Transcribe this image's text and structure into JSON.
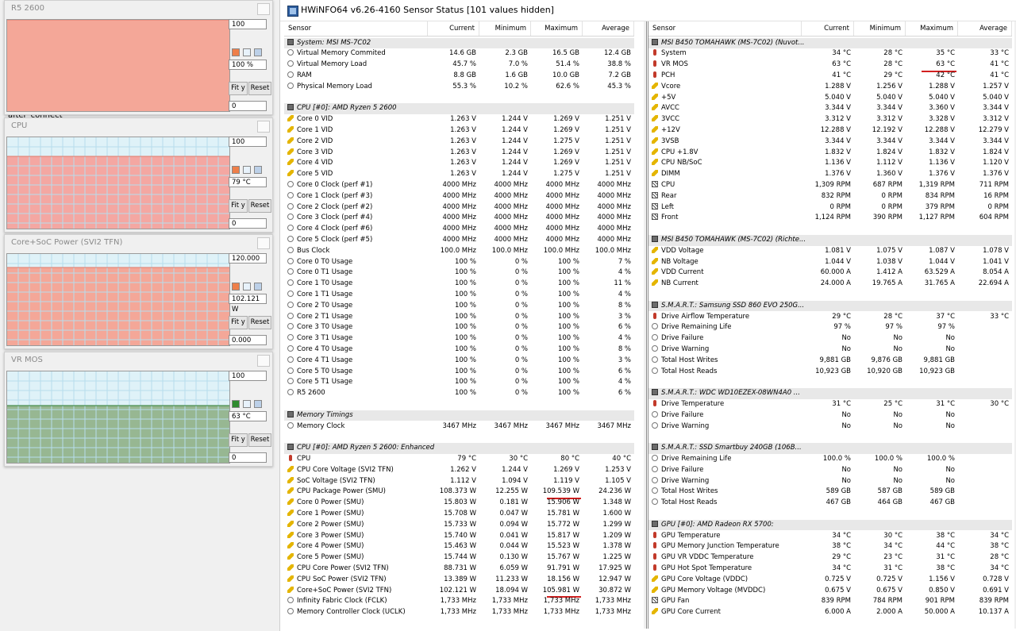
{
  "background": {
    "fragment_text": "after_connect"
  },
  "graphs": [
    {
      "title": "R5 2600",
      "max": "100",
      "current": "100 %",
      "min": "0",
      "fit": "Fit y",
      "reset": "Reset",
      "level": 1.0,
      "color": "#f4a798",
      "grid": "#f4a798",
      "band": "#f4a798",
      "swatch": "#ee7f4a"
    },
    {
      "title": "CPU",
      "max": "100",
      "current": "79 °C",
      "min": "0",
      "fit": "Fit y",
      "reset": "Reset",
      "level": 0.79,
      "color": "#f4a7a2",
      "grid": "#b7dcec",
      "band": "#dff2f8",
      "swatch": "#ee7f4a"
    },
    {
      "title": "Core+SoC Power (SVI2 TFN)",
      "max": "120.000",
      "current": "102.121 W",
      "min": "0.000",
      "fit": "Fit y",
      "reset": "Reset",
      "level": 0.851,
      "color": "#f4a798",
      "grid": "#b7dcec",
      "band": "#dff2f8",
      "swatch": "#ee7f4a"
    },
    {
      "title": "VR MOS",
      "max": "100",
      "current": "63 °C",
      "min": "0",
      "fit": "Fit y",
      "reset": "Reset",
      "level": 0.63,
      "color": "#97b792",
      "grid": "#b7dcec",
      "band": "#dff2f8",
      "swatch": "#2e8b2e"
    }
  ],
  "window": {
    "title": "HWiNFO64 v6.26-4160 Sensor Status [101 values hidden]"
  },
  "columns": {
    "sensor": "Sensor",
    "current": "Current",
    "minimum": "Minimum",
    "maximum": "Maximum",
    "average": "Average"
  },
  "left_rows": [
    {
      "t": "g",
      "name": "System: MSI MS-7C02"
    },
    {
      "t": "r",
      "icon": "circle",
      "name": "Virtual Memory Commited",
      "cur": "14.6 GB",
      "min": "2.3 GB",
      "max": "16.5 GB",
      "avg": "12.4 GB"
    },
    {
      "t": "r",
      "icon": "circle",
      "name": "Virtual Memory Load",
      "cur": "45.7 %",
      "min": "7.0 %",
      "max": "51.4 %",
      "avg": "38.8 %"
    },
    {
      "t": "r",
      "icon": "circle",
      "name": "RAM",
      "cur": "8.8 GB",
      "min": "1.6 GB",
      "max": "10.0 GB",
      "avg": "7.2 GB"
    },
    {
      "t": "r",
      "icon": "circle",
      "name": "Physical Memory Load",
      "cur": "55.3 %",
      "min": "10.2 %",
      "max": "62.6 %",
      "avg": "45.3 %"
    },
    {
      "t": "s"
    },
    {
      "t": "g",
      "name": "CPU [#0]: AMD Ryzen 5 2600"
    },
    {
      "t": "r",
      "icon": "bolt",
      "name": "Core 0 VID",
      "cur": "1.263 V",
      "min": "1.244 V",
      "max": "1.269 V",
      "avg": "1.251 V"
    },
    {
      "t": "r",
      "icon": "bolt",
      "name": "Core 1 VID",
      "cur": "1.263 V",
      "min": "1.244 V",
      "max": "1.269 V",
      "avg": "1.251 V"
    },
    {
      "t": "r",
      "icon": "bolt",
      "name": "Core 2 VID",
      "cur": "1.263 V",
      "min": "1.244 V",
      "max": "1.275 V",
      "avg": "1.251 V"
    },
    {
      "t": "r",
      "icon": "bolt",
      "name": "Core 3 VID",
      "cur": "1.263 V",
      "min": "1.244 V",
      "max": "1.269 V",
      "avg": "1.251 V"
    },
    {
      "t": "r",
      "icon": "bolt",
      "name": "Core 4 VID",
      "cur": "1.263 V",
      "min": "1.244 V",
      "max": "1.269 V",
      "avg": "1.251 V"
    },
    {
      "t": "r",
      "icon": "bolt",
      "name": "Core 5 VID",
      "cur": "1.263 V",
      "min": "1.244 V",
      "max": "1.275 V",
      "avg": "1.251 V"
    },
    {
      "t": "r",
      "icon": "circle",
      "name": "Core 0 Clock (perf #1)",
      "cur": "4000 MHz",
      "min": "4000 MHz",
      "max": "4000 MHz",
      "avg": "4000 MHz"
    },
    {
      "t": "r",
      "icon": "circle",
      "name": "Core 1 Clock (perf #3)",
      "cur": "4000 MHz",
      "min": "4000 MHz",
      "max": "4000 MHz",
      "avg": "4000 MHz"
    },
    {
      "t": "r",
      "icon": "circle",
      "name": "Core 2 Clock (perf #2)",
      "cur": "4000 MHz",
      "min": "4000 MHz",
      "max": "4000 MHz",
      "avg": "4000 MHz"
    },
    {
      "t": "r",
      "icon": "circle",
      "name": "Core 3 Clock (perf #4)",
      "cur": "4000 MHz",
      "min": "4000 MHz",
      "max": "4000 MHz",
      "avg": "4000 MHz"
    },
    {
      "t": "r",
      "icon": "circle",
      "name": "Core 4 Clock (perf #6)",
      "cur": "4000 MHz",
      "min": "4000 MHz",
      "max": "4000 MHz",
      "avg": "4000 MHz"
    },
    {
      "t": "r",
      "icon": "circle",
      "name": "Core 5 Clock (perf #5)",
      "cur": "4000 MHz",
      "min": "4000 MHz",
      "max": "4000 MHz",
      "avg": "4000 MHz"
    },
    {
      "t": "r",
      "icon": "circle",
      "name": "Bus Clock",
      "cur": "100.0 MHz",
      "min": "100.0 MHz",
      "max": "100.0 MHz",
      "avg": "100.0 MHz"
    },
    {
      "t": "r",
      "icon": "circle",
      "name": "Core 0 T0 Usage",
      "cur": "100 %",
      "min": "0 %",
      "max": "100 %",
      "avg": "7 %"
    },
    {
      "t": "r",
      "icon": "circle",
      "name": "Core 0 T1 Usage",
      "cur": "100 %",
      "min": "0 %",
      "max": "100 %",
      "avg": "4 %"
    },
    {
      "t": "r",
      "icon": "circle",
      "name": "Core 1 T0 Usage",
      "cur": "100 %",
      "min": "0 %",
      "max": "100 %",
      "avg": "11 %"
    },
    {
      "t": "r",
      "icon": "circle",
      "name": "Core 1 T1 Usage",
      "cur": "100 %",
      "min": "0 %",
      "max": "100 %",
      "avg": "4 %"
    },
    {
      "t": "r",
      "icon": "circle",
      "name": "Core 2 T0 Usage",
      "cur": "100 %",
      "min": "0 %",
      "max": "100 %",
      "avg": "8 %"
    },
    {
      "t": "r",
      "icon": "circle",
      "name": "Core 2 T1 Usage",
      "cur": "100 %",
      "min": "0 %",
      "max": "100 %",
      "avg": "3 %"
    },
    {
      "t": "r",
      "icon": "circle",
      "name": "Core 3 T0 Usage",
      "cur": "100 %",
      "min": "0 %",
      "max": "100 %",
      "avg": "6 %"
    },
    {
      "t": "r",
      "icon": "circle",
      "name": "Core 3 T1 Usage",
      "cur": "100 %",
      "min": "0 %",
      "max": "100 %",
      "avg": "4 %"
    },
    {
      "t": "r",
      "icon": "circle",
      "name": "Core 4 T0 Usage",
      "cur": "100 %",
      "min": "0 %",
      "max": "100 %",
      "avg": "8 %"
    },
    {
      "t": "r",
      "icon": "circle",
      "name": "Core 4 T1 Usage",
      "cur": "100 %",
      "min": "0 %",
      "max": "100 %",
      "avg": "3 %"
    },
    {
      "t": "r",
      "icon": "circle",
      "name": "Core 5 T0 Usage",
      "cur": "100 %",
      "min": "0 %",
      "max": "100 %",
      "avg": "6 %"
    },
    {
      "t": "r",
      "icon": "circle",
      "name": "Core 5 T1 Usage",
      "cur": "100 %",
      "min": "0 %",
      "max": "100 %",
      "avg": "4 %"
    },
    {
      "t": "r",
      "icon": "circle",
      "name": "R5 2600",
      "cur": "100 %",
      "min": "0 %",
      "max": "100 %",
      "avg": "6 %"
    },
    {
      "t": "s"
    },
    {
      "t": "g",
      "name": "Memory Timings"
    },
    {
      "t": "r",
      "icon": "circle",
      "name": "Memory Clock",
      "cur": "3467 MHz",
      "min": "3467 MHz",
      "max": "3467 MHz",
      "avg": "3467 MHz"
    },
    {
      "t": "s"
    },
    {
      "t": "g",
      "name": "CPU [#0]: AMD Ryzen 5 2600: Enhanced"
    },
    {
      "t": "r",
      "icon": "therm",
      "name": "CPU",
      "cur": "79 °C",
      "min": "30 °C",
      "max": "80 °C",
      "avg": "40 °C"
    },
    {
      "t": "r",
      "icon": "bolt",
      "name": "CPU Core Voltage (SVI2 TFN)",
      "cur": "1.262 V",
      "min": "1.244 V",
      "max": "1.269 V",
      "avg": "1.253 V"
    },
    {
      "t": "r",
      "icon": "bolt",
      "name": "SoC Voltage (SVI2 TFN)",
      "cur": "1.112 V",
      "min": "1.094 V",
      "max": "1.119 V",
      "avg": "1.105 V"
    },
    {
      "t": "r",
      "icon": "bolt",
      "name": "CPU Package Power (SMU)",
      "cur": "108.373 W",
      "min": "12.255 W",
      "max": "109.539 W",
      "avg": "24.236 W",
      "hl": true
    },
    {
      "t": "r",
      "icon": "bolt",
      "name": "Core 0 Power (SMU)",
      "cur": "15.803 W",
      "min": "0.181 W",
      "max": "15.906 W",
      "avg": "1.348 W"
    },
    {
      "t": "r",
      "icon": "bolt",
      "name": "Core 1 Power (SMU)",
      "cur": "15.708 W",
      "min": "0.047 W",
      "max": "15.781 W",
      "avg": "1.600 W"
    },
    {
      "t": "r",
      "icon": "bolt",
      "name": "Core 2 Power (SMU)",
      "cur": "15.733 W",
      "min": "0.094 W",
      "max": "15.772 W",
      "avg": "1.299 W"
    },
    {
      "t": "r",
      "icon": "bolt",
      "name": "Core 3 Power (SMU)",
      "cur": "15.740 W",
      "min": "0.041 W",
      "max": "15.817 W",
      "avg": "1.209 W"
    },
    {
      "t": "r",
      "icon": "bolt",
      "name": "Core 4 Power (SMU)",
      "cur": "15.463 W",
      "min": "0.044 W",
      "max": "15.523 W",
      "avg": "1.378 W"
    },
    {
      "t": "r",
      "icon": "bolt",
      "name": "Core 5 Power (SMU)",
      "cur": "15.744 W",
      "min": "0.130 W",
      "max": "15.767 W",
      "avg": "1.225 W"
    },
    {
      "t": "r",
      "icon": "bolt",
      "name": "CPU Core Power (SVI2 TFN)",
      "cur": "88.731 W",
      "min": "6.059 W",
      "max": "91.791 W",
      "avg": "17.925 W"
    },
    {
      "t": "r",
      "icon": "bolt",
      "name": "CPU SoC Power (SVI2 TFN)",
      "cur": "13.389 W",
      "min": "11.233 W",
      "max": "18.156 W",
      "avg": "12.947 W"
    },
    {
      "t": "r",
      "icon": "bolt",
      "name": "Core+SoC Power (SVI2 TFN)",
      "cur": "102.121 W",
      "min": "18.094 W",
      "max": "105.981 W",
      "avg": "30.872 W",
      "hl": true
    },
    {
      "t": "r",
      "icon": "circle",
      "name": "Infinity Fabric Clock (FCLK)",
      "cur": "1,733 MHz",
      "min": "1,733 MHz",
      "max": "1,733 MHz",
      "avg": "1,733 MHz"
    },
    {
      "t": "r",
      "icon": "circle",
      "name": "Memory Controller Clock (UCLK)",
      "cur": "1,733 MHz",
      "min": "1,733 MHz",
      "max": "1,733 MHz",
      "avg": "1,733 MHz"
    }
  ],
  "right_rows": [
    {
      "t": "g",
      "name": "MSI B450 TOMAHAWK (MS-7C02) (Nuvot..."
    },
    {
      "t": "r",
      "icon": "therm",
      "name": "System",
      "cur": "34 °C",
      "min": "28 °C",
      "max": "35 °C",
      "avg": "33 °C"
    },
    {
      "t": "r",
      "icon": "therm",
      "name": "VR MOS",
      "cur": "63 °C",
      "min": "28 °C",
      "max": "63 °C",
      "avg": "41 °C",
      "hl": true
    },
    {
      "t": "r",
      "icon": "therm",
      "name": "PCH",
      "cur": "41 °C",
      "min": "29 °C",
      "max": "42 °C",
      "avg": "41 °C"
    },
    {
      "t": "r",
      "icon": "bolt",
      "name": "Vcore",
      "cur": "1.288 V",
      "min": "1.256 V",
      "max": "1.288 V",
      "avg": "1.257 V"
    },
    {
      "t": "r",
      "icon": "bolt",
      "name": "+5V",
      "cur": "5.040 V",
      "min": "5.040 V",
      "max": "5.040 V",
      "avg": "5.040 V"
    },
    {
      "t": "r",
      "icon": "bolt",
      "name": "AVCC",
      "cur": "3.344 V",
      "min": "3.344 V",
      "max": "3.360 V",
      "avg": "3.344 V"
    },
    {
      "t": "r",
      "icon": "bolt",
      "name": "3VCC",
      "cur": "3.312 V",
      "min": "3.312 V",
      "max": "3.328 V",
      "avg": "3.312 V"
    },
    {
      "t": "r",
      "icon": "bolt",
      "name": "+12V",
      "cur": "12.288 V",
      "min": "12.192 V",
      "max": "12.288 V",
      "avg": "12.279 V"
    },
    {
      "t": "r",
      "icon": "bolt",
      "name": "3VSB",
      "cur": "3.344 V",
      "min": "3.344 V",
      "max": "3.344 V",
      "avg": "3.344 V"
    },
    {
      "t": "r",
      "icon": "bolt",
      "name": "CPU +1.8V",
      "cur": "1.832 V",
      "min": "1.824 V",
      "max": "1.832 V",
      "avg": "1.824 V"
    },
    {
      "t": "r",
      "icon": "bolt",
      "name": "CPU NB/SoC",
      "cur": "1.136 V",
      "min": "1.112 V",
      "max": "1.136 V",
      "avg": "1.120 V"
    },
    {
      "t": "r",
      "icon": "bolt",
      "name": "DIMM",
      "cur": "1.376 V",
      "min": "1.360 V",
      "max": "1.376 V",
      "avg": "1.376 V"
    },
    {
      "t": "r",
      "icon": "fan",
      "name": "CPU",
      "cur": "1,309 RPM",
      "min": "687 RPM",
      "max": "1,319 RPM",
      "avg": "711 RPM"
    },
    {
      "t": "r",
      "icon": "fan",
      "name": "Rear",
      "cur": "832 RPM",
      "min": "0 RPM",
      "max": "834 RPM",
      "avg": "16 RPM"
    },
    {
      "t": "r",
      "icon": "fan",
      "name": "Left",
      "cur": "0 RPM",
      "min": "0 RPM",
      "max": "379 RPM",
      "avg": "0 RPM"
    },
    {
      "t": "r",
      "icon": "fan",
      "name": "Front",
      "cur": "1,124 RPM",
      "min": "390 RPM",
      "max": "1,127 RPM",
      "avg": "604 RPM"
    },
    {
      "t": "s"
    },
    {
      "t": "g",
      "name": "MSI B450 TOMAHAWK (MS-7C02) (Richte..."
    },
    {
      "t": "r",
      "icon": "bolt",
      "name": "VDD Voltage",
      "cur": "1.081 V",
      "min": "1.075 V",
      "max": "1.087 V",
      "avg": "1.078 V"
    },
    {
      "t": "r",
      "icon": "bolt",
      "name": "NB Voltage",
      "cur": "1.044 V",
      "min": "1.038 V",
      "max": "1.044 V",
      "avg": "1.041 V"
    },
    {
      "t": "r",
      "icon": "bolt",
      "name": "VDD Current",
      "cur": "60.000 A",
      "min": "1.412 A",
      "max": "63.529 A",
      "avg": "8.054 A"
    },
    {
      "t": "r",
      "icon": "bolt",
      "name": "NB Current",
      "cur": "24.000 A",
      "min": "19.765 A",
      "max": "31.765 A",
      "avg": "22.694 A"
    },
    {
      "t": "s"
    },
    {
      "t": "g",
      "name": "S.M.A.R.T.: Samsung SSD 860 EVO 250G..."
    },
    {
      "t": "r",
      "icon": "therm",
      "name": "Drive Airflow Temperature",
      "cur": "29 °C",
      "min": "28 °C",
      "max": "37 °C",
      "avg": "33 °C"
    },
    {
      "t": "r",
      "icon": "circle",
      "name": "Drive Remaining Life",
      "cur": "97 %",
      "min": "97 %",
      "max": "97 %",
      "avg": ""
    },
    {
      "t": "r",
      "icon": "circle",
      "name": "Drive Failure",
      "cur": "No",
      "min": "No",
      "max": "No",
      "avg": ""
    },
    {
      "t": "r",
      "icon": "circle",
      "name": "Drive Warning",
      "cur": "No",
      "min": "No",
      "max": "No",
      "avg": ""
    },
    {
      "t": "r",
      "icon": "circle",
      "name": "Total Host Writes",
      "cur": "9,881 GB",
      "min": "9,876 GB",
      "max": "9,881 GB",
      "avg": ""
    },
    {
      "t": "r",
      "icon": "circle",
      "name": "Total Host Reads",
      "cur": "10,923 GB",
      "min": "10,920 GB",
      "max": "10,923 GB",
      "avg": ""
    },
    {
      "t": "s"
    },
    {
      "t": "g",
      "name": "S.M.A.R.T.: WDC WD10EZEX-08WN4A0 ..."
    },
    {
      "t": "r",
      "icon": "therm",
      "name": "Drive Temperature",
      "cur": "31 °C",
      "min": "25 °C",
      "max": "31 °C",
      "avg": "30 °C"
    },
    {
      "t": "r",
      "icon": "circle",
      "name": "Drive Failure",
      "cur": "No",
      "min": "No",
      "max": "No",
      "avg": ""
    },
    {
      "t": "r",
      "icon": "circle",
      "name": "Drive Warning",
      "cur": "No",
      "min": "No",
      "max": "No",
      "avg": ""
    },
    {
      "t": "s"
    },
    {
      "t": "g",
      "name": "S.M.A.R.T.: SSD Smartbuy 240GB (106B..."
    },
    {
      "t": "r",
      "icon": "circle",
      "name": "Drive Remaining Life",
      "cur": "100.0 %",
      "min": "100.0 %",
      "max": "100.0 %",
      "avg": ""
    },
    {
      "t": "r",
      "icon": "circle",
      "name": "Drive Failure",
      "cur": "No",
      "min": "No",
      "max": "No",
      "avg": ""
    },
    {
      "t": "r",
      "icon": "circle",
      "name": "Drive Warning",
      "cur": "No",
      "min": "No",
      "max": "No",
      "avg": ""
    },
    {
      "t": "r",
      "icon": "circle",
      "name": "Total Host Writes",
      "cur": "589 GB",
      "min": "587 GB",
      "max": "589 GB",
      "avg": ""
    },
    {
      "t": "r",
      "icon": "circle",
      "name": "Total Host Reads",
      "cur": "467 GB",
      "min": "464 GB",
      "max": "467 GB",
      "avg": ""
    },
    {
      "t": "s"
    },
    {
      "t": "g",
      "name": "GPU [#0]: AMD Radeon RX 5700:"
    },
    {
      "t": "r",
      "icon": "therm",
      "name": "GPU Temperature",
      "cur": "34 °C",
      "min": "30 °C",
      "max": "38 °C",
      "avg": "34 °C"
    },
    {
      "t": "r",
      "icon": "therm",
      "name": "GPU Memory Junction Temperature",
      "cur": "38 °C",
      "min": "34 °C",
      "max": "44 °C",
      "avg": "38 °C"
    },
    {
      "t": "r",
      "icon": "therm",
      "name": "GPU VR VDDC Temperature",
      "cur": "29 °C",
      "min": "23 °C",
      "max": "31 °C",
      "avg": "28 °C"
    },
    {
      "t": "r",
      "icon": "therm",
      "name": "GPU Hot Spot Temperature",
      "cur": "34 °C",
      "min": "31 °C",
      "max": "38 °C",
      "avg": "34 °C"
    },
    {
      "t": "r",
      "icon": "bolt",
      "name": "GPU Core Voltage (VDDC)",
      "cur": "0.725 V",
      "min": "0.725 V",
      "max": "1.156 V",
      "avg": "0.728 V"
    },
    {
      "t": "r",
      "icon": "bolt",
      "name": "GPU Memory Voltage (MVDDC)",
      "cur": "0.675 V",
      "min": "0.675 V",
      "max": "0.850 V",
      "avg": "0.691 V"
    },
    {
      "t": "r",
      "icon": "fan",
      "name": "GPU Fan",
      "cur": "839 RPM",
      "min": "784 RPM",
      "max": "901 RPM",
      "avg": "839 RPM"
    },
    {
      "t": "r",
      "icon": "bolt",
      "name": "GPU Core Current",
      "cur": "6.000 A",
      "min": "2.000 A",
      "max": "50.000 A",
      "avg": "10.137 A"
    }
  ]
}
